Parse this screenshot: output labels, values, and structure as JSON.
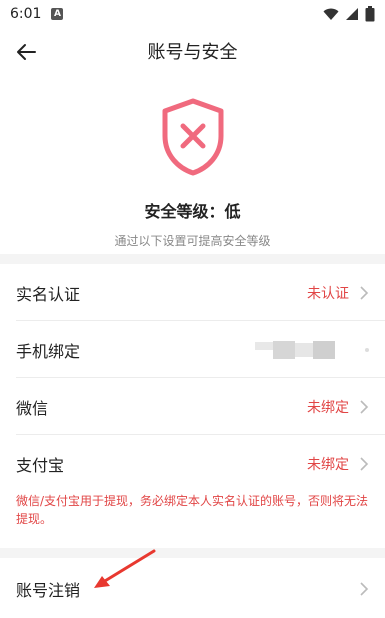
{
  "status_bar": {
    "time": "6:01",
    "app_badge": "A"
  },
  "header": {
    "title": "账号与安全"
  },
  "security": {
    "level_label": "安全等级：低",
    "hint": "通过以下设置可提高安全等级",
    "shield_color": "#f06a7e"
  },
  "rows": [
    {
      "label": "实名认证",
      "value": "未认证"
    },
    {
      "label": "手机绑定",
      "value": ""
    },
    {
      "label": "微信",
      "value": "未绑定"
    },
    {
      "label": "支付宝",
      "value": "未绑定"
    }
  ],
  "notice": "微信/支付宝用于提现，务必绑定本人实名认证的账号，否则将无法提现。",
  "cancel_account": {
    "label": "账号注销"
  },
  "colors": {
    "accent_red": "#e14545",
    "gap_bg": "#f4f4f4"
  }
}
